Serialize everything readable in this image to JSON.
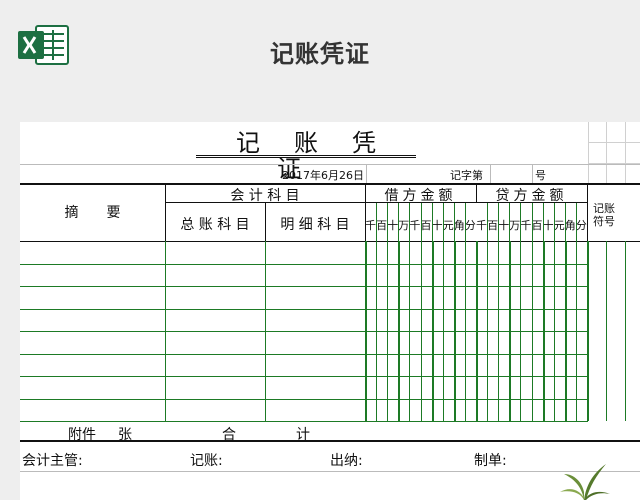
{
  "page": {
    "title": "记账凭证"
  },
  "voucher": {
    "title": "记账凭证",
    "date": "2017年6月26日",
    "number_label": "记字第",
    "number_suffix": "号",
    "header": {
      "summary": "摘　　要",
      "subject_group": "会 计 科 目",
      "general_ledger": "总 账 科 目",
      "detail": "明 细 科 目",
      "debit": "借方金额",
      "credit": "贷方金额",
      "posting_mark": "记账符号",
      "digit_units": [
        "千",
        "百",
        "十",
        "万",
        "千",
        "百",
        "十",
        "元",
        "角",
        "分"
      ]
    },
    "attachment_label": "附件",
    "attachment_unit": "张",
    "total_left": "合",
    "total_right": "计",
    "signatures": {
      "supervisor": "会计主管:",
      "bookkeeper": "记账:",
      "cashier": "出纳:",
      "preparer": "制单:"
    }
  },
  "colors": {
    "green_grid": "#1d7a25",
    "excel_green": "#1d6f42"
  },
  "icons": [
    "excel-logo-icon",
    "plant-icon"
  ]
}
